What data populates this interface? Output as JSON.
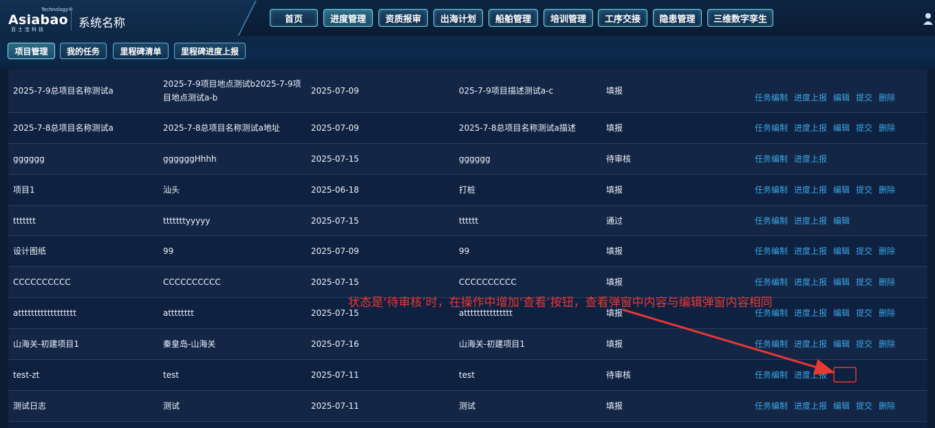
{
  "brand": {
    "logo_tech": "Technology®",
    "logo_main": "Asiabao",
    "logo_sub": "亚士宝科技",
    "app_name": "系统名称"
  },
  "nav": [
    {
      "label": "首页",
      "active": false
    },
    {
      "label": "进度管理",
      "active": true
    },
    {
      "label": "资质报审",
      "active": false
    },
    {
      "label": "出海计划",
      "active": false
    },
    {
      "label": "船舶管理",
      "active": false
    },
    {
      "label": "培训管理",
      "active": false
    },
    {
      "label": "工序交接",
      "active": false
    },
    {
      "label": "隐患管理",
      "active": false
    },
    {
      "label": "三维数字孪生",
      "active": false
    }
  ],
  "subnav": [
    {
      "label": "项目管理",
      "active": true
    },
    {
      "label": "我的任务",
      "active": false
    },
    {
      "label": "里程碑清单",
      "active": false
    },
    {
      "label": "里程碑进度上报",
      "active": false
    }
  ],
  "rows": [
    {
      "name": "2025-7-9总项目名称测试a",
      "address": "2025-7-9项目地点测试b2025-7-9项目地点测试a-b",
      "date": "2025-07-09",
      "desc": "025-7-9项目描述测试a-c",
      "status": "填报",
      "ops": [
        "任务编制",
        "进度上报",
        "编辑",
        "提交",
        "删除"
      ]
    },
    {
      "name": "2025-7-8总项目名称测试a",
      "address": "2025-7-8总项目名称测试a地址",
      "date": "2025-07-09",
      "desc": "2025-7-8总项目名称测试a描述",
      "status": "填报",
      "ops": [
        "任务编制",
        "进度上报",
        "编辑",
        "提交",
        "删除"
      ]
    },
    {
      "name": "gggggg",
      "address": "ggggggHhhh",
      "date": "2025-07-15",
      "desc": "gggggg",
      "status": "待审核",
      "ops": [
        "任务编制",
        "进度上报"
      ]
    },
    {
      "name": "项目1",
      "address": "汕头",
      "date": "2025-06-18",
      "desc": "打桩",
      "status": "填报",
      "ops": [
        "任务编制",
        "进度上报",
        "编辑",
        "提交",
        "删除"
      ]
    },
    {
      "name": "ttttttt",
      "address": "tttttttyyyyy",
      "date": "2025-07-15",
      "desc": "tttttt",
      "status": "通过",
      "ops": [
        "任务编制",
        "进度上报",
        "编辑"
      ]
    },
    {
      "name": "设计图纸",
      "address": "99",
      "date": "2025-07-09",
      "desc": "99",
      "status": "填报",
      "ops": [
        "任务编制",
        "进度上报",
        "编辑",
        "提交",
        "删除"
      ]
    },
    {
      "name": "CCCCCCCCCC",
      "address": "CCCCCCCCCC",
      "date": "2025-07-15",
      "desc": "CCCCCCCCCC",
      "status": "填报",
      "ops": [
        "任务编制",
        "进度上报",
        "编辑",
        "提交",
        "删除"
      ]
    },
    {
      "name": "atttttttttttttttttt",
      "address": "atttttttt",
      "date": "2025-07-15",
      "desc": "attttttttttttttt",
      "status": "填报",
      "ops": [
        "任务编制",
        "进度上报",
        "编辑",
        "提交",
        "删除"
      ]
    },
    {
      "name": "山海关-初建项目1",
      "address": "秦皇岛-山海关",
      "date": "2025-07-16",
      "desc": "山海关-初建项目1",
      "status": "填报",
      "ops": [
        "任务编制",
        "进度上报",
        "编辑",
        "提交",
        "删除"
      ]
    },
    {
      "name": "test-zt",
      "address": "test",
      "date": "2025-07-11",
      "desc": "test",
      "status": "待审核",
      "ops": [
        "任务编制",
        "进度上报"
      ]
    },
    {
      "name": "测试日志",
      "address": "测试",
      "date": "2025-07-11",
      "desc": "测试",
      "status": "填报",
      "ops": [
        "任务编制",
        "进度上报",
        "编辑",
        "提交",
        "删除"
      ]
    }
  ],
  "annotation": {
    "text": "状态是‘待审核’时，在操作中增加‘查看’按钮，查看弹窗中内容与编辑弹窗内容相同",
    "color": "#e53935"
  },
  "colors": {
    "link": "#3aa6e6",
    "nav_border": "#6fd6ea"
  }
}
